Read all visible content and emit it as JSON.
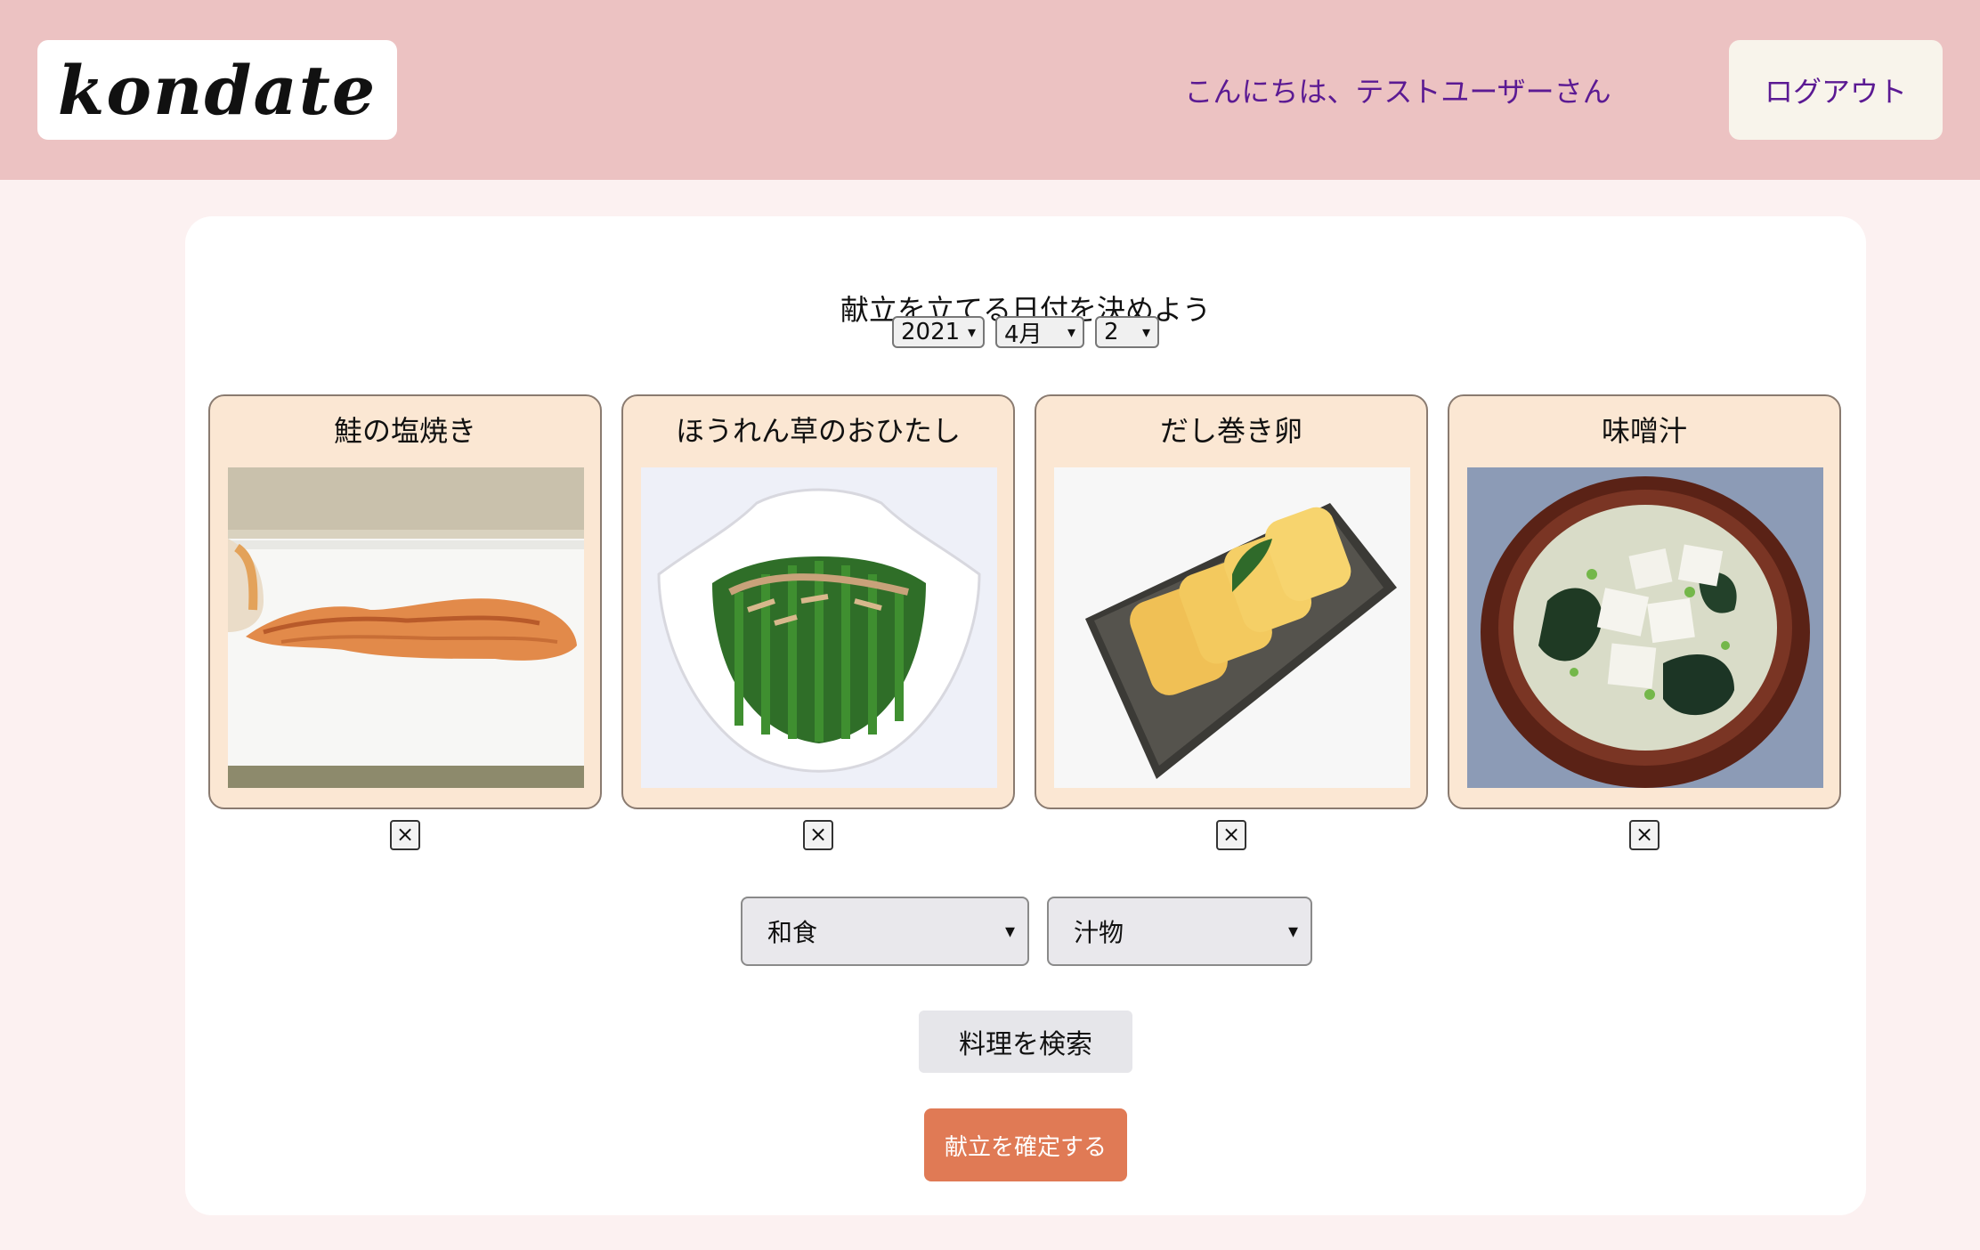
{
  "header": {
    "logo_text": "kondate",
    "greeting": "こんにちは、テストユーザーさん",
    "logout_label": "ログアウト"
  },
  "date_picker": {
    "title": "献立を立てる日付を決めよう",
    "year": "2021",
    "month": "4月",
    "day": "2"
  },
  "dishes": [
    {
      "name": "鮭の塩焼き",
      "photo": "grilled-salmon-photo"
    },
    {
      "name": "ほうれん草のおひたし",
      "photo": "spinach-ohitashi-photo"
    },
    {
      "name": "だし巻き卵",
      "photo": "dashimaki-egg-photo"
    },
    {
      "name": "味噌汁",
      "photo": "miso-soup-photo"
    }
  ],
  "remove_label": "×",
  "filters": {
    "cuisine": "和食",
    "category": "汁物"
  },
  "search_label": "料理を検索",
  "confirm_label": "献立を確定する"
}
